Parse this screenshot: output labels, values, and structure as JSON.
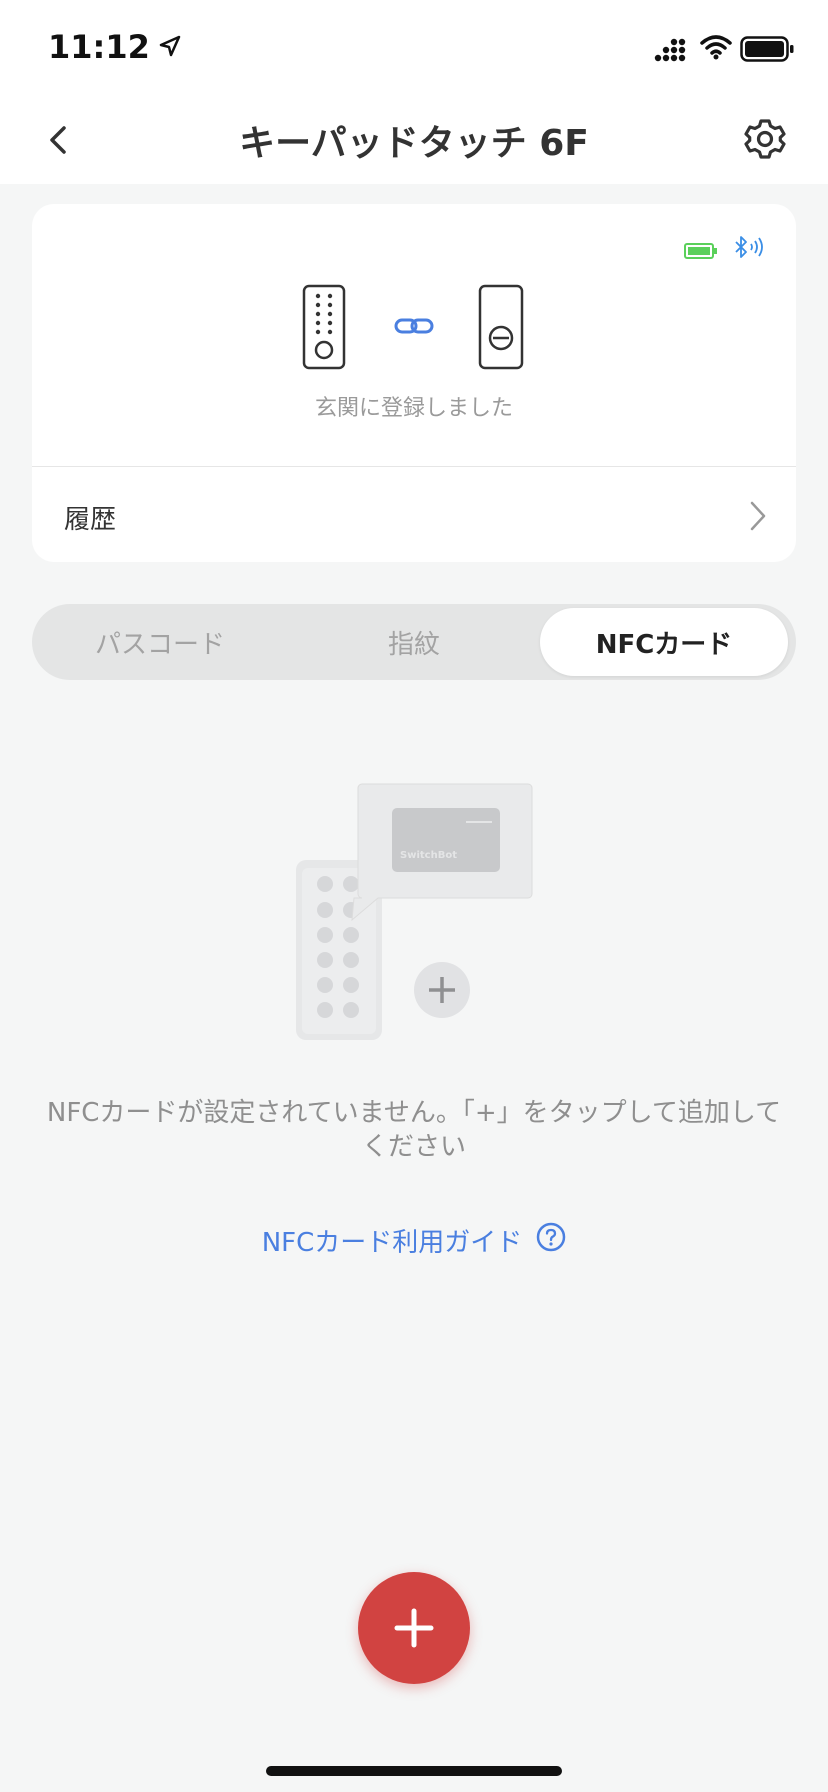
{
  "status_bar": {
    "time": "11:12"
  },
  "nav": {
    "title": "キーパッドタッチ 6F",
    "back_icon": "chevron-left-icon",
    "settings_icon": "gear-icon"
  },
  "device_card": {
    "status_text": "玄関に登録しました",
    "history_label": "履歴",
    "battery_color": "#5ad05a",
    "bluetooth_color": "#3a8ee6"
  },
  "tabs": [
    {
      "label": "パスコード",
      "selected": false
    },
    {
      "label": "指紋",
      "selected": false
    },
    {
      "label": "NFCカード",
      "selected": true
    }
  ],
  "empty_state": {
    "card_brand": "SwitchBot",
    "message": "NFCカードが設定されていません。「+」をタップして追加してください",
    "guide_link": "NFCカード利用ガイド"
  },
  "colors": {
    "accent_red": "#d14341",
    "link_blue": "#4a7fe0"
  }
}
